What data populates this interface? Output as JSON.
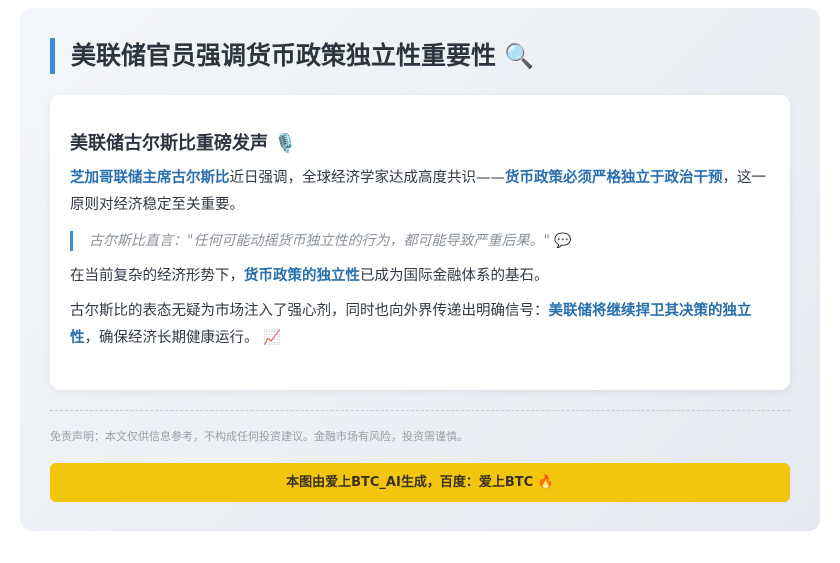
{
  "header": {
    "title": "美联储官员强调货币政策独立性重要性",
    "title_icon": "🔍"
  },
  "article": {
    "section_title": "美联储古尔斯比重磅发声",
    "section_icon": "🎙️",
    "p1": {
      "hl1": "芝加哥联储主席古尔斯比",
      "t1": "近日强调，全球经济学家达成高度共识——",
      "hl2": "货币政策必须严格独立于政治干预",
      "t2": "，这一原则对经济稳定至关重要。"
    },
    "quote": {
      "text": "古尔斯比直言：\"任何可能动摇货币独立性的行为，都可能导致严重后果。\"",
      "icon": "💬"
    },
    "p2": {
      "t1": "在当前复杂的经济形势下，",
      "hl1": "货币政策的独立性",
      "t2": "已成为国际金融体系的基石。"
    },
    "p3": {
      "t1": "古尔斯比的表态无疑为市场注入了强心剂，同时也向外界传递出明确信号：",
      "hl1": "美联储将继续捍卫其决策的独立性",
      "t2": "，确保经济长期健康运行。",
      "icon": "📈"
    }
  },
  "disclaimer": "免责声明：本文仅供信息参考，不构成任何投资建议。金融市场有风险，投资需谨慎。",
  "footer": {
    "text": "本图由爱上BTC_AI生成，百度：爱上BTC",
    "icon": "🔥"
  },
  "colors": {
    "accent": "#3a8ed6",
    "highlight": "#2a6fad",
    "banner": "#f2c50f"
  }
}
